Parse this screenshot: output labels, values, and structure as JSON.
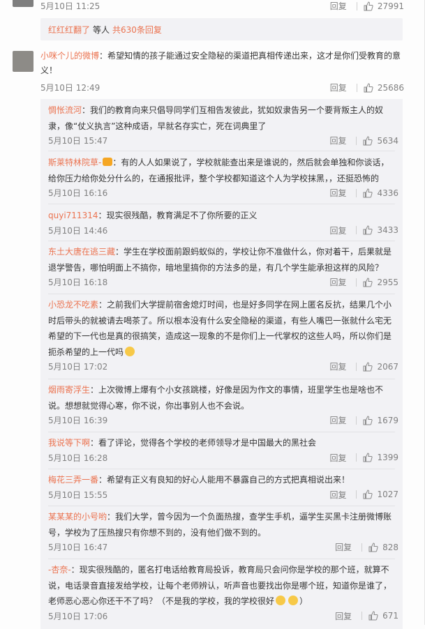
{
  "top": {
    "time": "5月10日 11:25",
    "reply": "回复",
    "likes": "27991"
  },
  "more": {
    "users": "红红红翻了",
    "mid": "等人",
    "count_link": "共630条回复"
  },
  "main_comment": {
    "user": "小咪个儿的微博",
    "text": "：希望知情的孩子能通过安全隐秘的渠道把真相传递出来，这才是你们受教育的意义！",
    "time": "5月10日 12:49",
    "reply": "回复",
    "likes": "25686"
  },
  "replies": [
    {
      "user": "惆怅流河",
      "text": "：我们的教育向来只倡导同学们互相告发彼此，犹如奴隶告另一个要背叛主人的奴隶，像“仗义执言”这种成语，早就名存实亡，死在词典里了",
      "time": "5月10日 15:47",
      "reply": "回复",
      "likes": "5634"
    },
    {
      "user": "斯莱特林院草-",
      "text": "：有的人人如果说了，学校就能查出来是谁说的，然后就会单独和你谈话，给你压力给你处分什么的，在通报批评，整个学校都知道这个人为学校抹黑，，还挺恐怖的",
      "time": "5月10日 16:16",
      "reply": "回复",
      "likes": "4336"
    },
    {
      "user": "quyi711314",
      "text": "：现实很残酷，教育满足不了你所要的正义",
      "time": "5月10日 14:46",
      "reply": "回复",
      "likes": "3433"
    },
    {
      "user": "东土大唐在逃三藏",
      "text": "：学生在学校面前跟蚂蚁似的，学校让你不准做什么，你对着干，后果就是退学警告，哪怕明面上不搞你，暗地里搞你的方法多的是，有几个学生能承担这样的风险？",
      "time": "5月10日 16:18",
      "reply": "回复",
      "likes": "2955"
    },
    {
      "user": "小恐龙不吃素",
      "text": "：之前我们大学提前宿舍熄灯时间，也是好多同学在网上匿名反抗，结果几个小时后带头的就被请去喝茶了。所以根本没有什么安全隐秘的渠道，有些人嘴巴一张就什么宅无希望的下一代也是真的很搞笑，造成这一现象的不是你们上一代掌权的这些人吗，所以你们是扼杀希望的上一代吗",
      "time": "5月10日 17:02",
      "reply": "回复",
      "likes": "2067"
    },
    {
      "user": "烟雨寄浮生",
      "text": "：上次微博上爆有个小女孩跳楼，好像是因为作文的事情，班里学生也是啥也不说。想想就觉得心寒，你不说，你出事别人也不会说。",
      "time": "5月10日 16:39",
      "reply": "回复",
      "likes": "1679"
    },
    {
      "user": "我说等下啊",
      "text": "：看了评论，觉得各个学校的老师领导才是中国最大的黑社会",
      "time": "5月10日 16:28",
      "reply": "回复",
      "likes": "1399"
    },
    {
      "user": "梅花三弄一番",
      "text": "：希望有正义有良知的好心人能用不暴露自己的方式把真相说出来！",
      "time": "5月10日 15:55",
      "reply": "回复",
      "likes": "1027"
    },
    {
      "user": "某某某的小号哟",
      "text": "：我们大学，曾今因为一个负面热搜，查学生手机，逼学生买黑卡注册微博账号，学校为了压热搜只有你想不到的，没有他们做不到的。",
      "time": "5月10日 16:47",
      "reply": "回复",
      "likes": "828"
    },
    {
      "user": "-杏奈-",
      "text": "：现实很残酷的，匿名打电话给教育局投诉，教育局只会问你是学校的那个班，就算不说，电话录音直接发给学校，让每个老师辨认，听声音也要找出你是哪个班，知道你是谁了，老师恶心恶心你还干不了吗？（不是我的学校，我的学校很好",
      "text_tail": "）",
      "time": "5月10日 17:06",
      "reply": "回复",
      "likes": "671"
    }
  ],
  "colors": {
    "link": "#eb7350",
    "meta": "#808080",
    "reply_bg": "#f2f2f5"
  }
}
